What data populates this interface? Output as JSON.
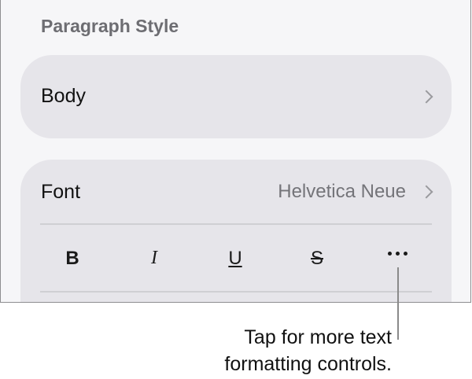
{
  "paragraph_style": {
    "title": "Paragraph Style",
    "value": "Body"
  },
  "font": {
    "label": "Font",
    "value": "Helvetica Neue"
  },
  "format_buttons": {
    "bold": "B",
    "italic": "I",
    "underline": "U",
    "strikethrough": "S"
  },
  "callout": {
    "line1": "Tap for more text",
    "line2": "formatting controls."
  }
}
